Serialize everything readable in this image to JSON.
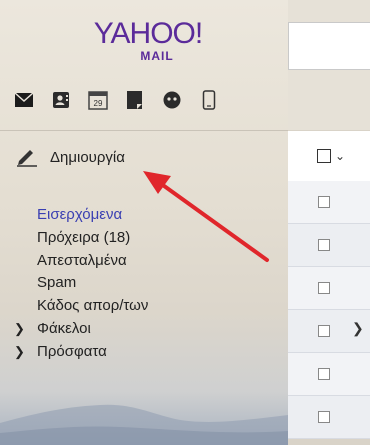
{
  "logo": {
    "brand": "YAHOO!",
    "product": "MAIL"
  },
  "app_icons": [
    "mail-icon",
    "contacts-icon",
    "calendar-icon",
    "notepad-icon",
    "messenger-icon",
    "mobile-icon"
  ],
  "calendar_day": "29",
  "compose": {
    "label": "Δημιουργία"
  },
  "folders": [
    {
      "label": "Εισερχόμενα",
      "active": true
    },
    {
      "label": "Πρόχειρα (18)"
    },
    {
      "label": "Απεσταλμένα"
    },
    {
      "label": "Spam"
    },
    {
      "label": "Κάδος απορ/των"
    },
    {
      "label": "Φάκελοι",
      "expandable": true
    },
    {
      "label": "Πρόσφατα",
      "expandable": true
    }
  ],
  "colors": {
    "brand": "#5b2b9a",
    "active_folder": "#3a3fb2",
    "annotation_arrow": "#e0262b"
  }
}
